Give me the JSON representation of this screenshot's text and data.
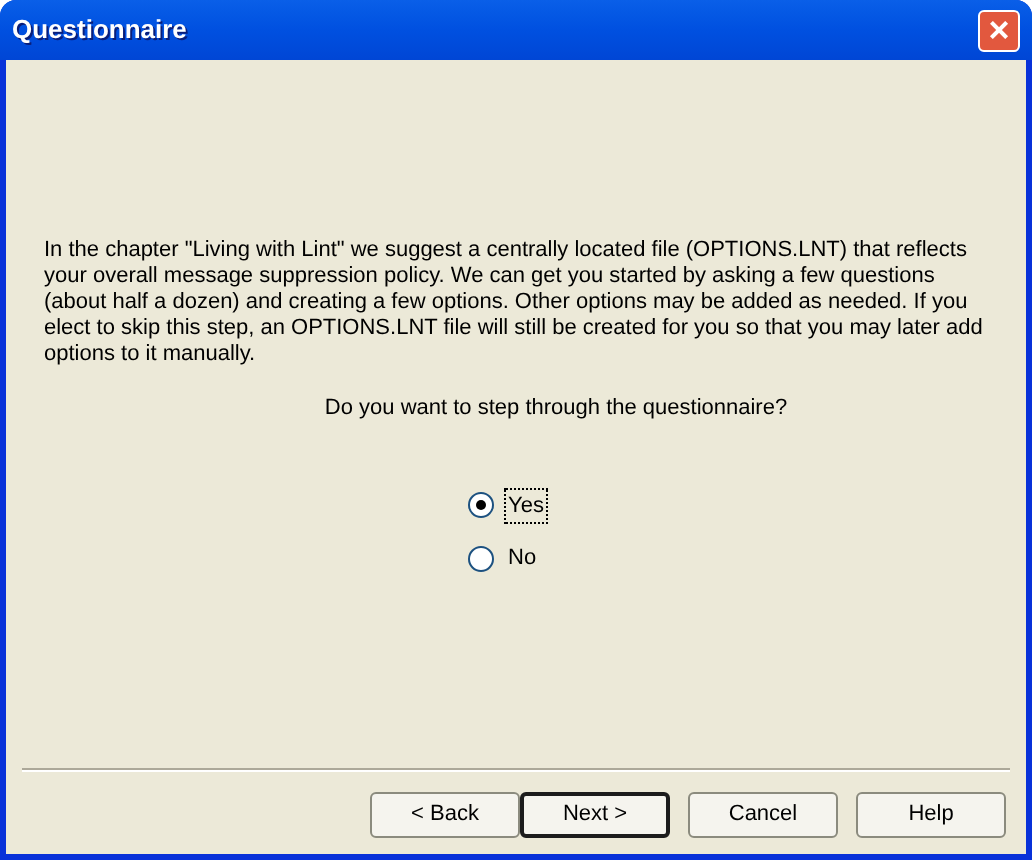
{
  "window": {
    "title": "Questionnaire",
    "close": "×"
  },
  "description": "In the chapter \"Living with Lint\" we suggest a centrally located file (OPTIONS.LNT) that reflects your overall message suppression policy.  We can get you started by asking a few questions (about half a dozen) and creating a few options.  Other options may be added as needed. If you elect to skip this step, an OPTIONS.LNT file will still be created for you so that you may later add options to it manually.",
  "question": "Do you want to step through the questionnaire?",
  "options": [
    {
      "label": "Yes",
      "selected": true,
      "focused": true
    },
    {
      "label": "No",
      "selected": false,
      "focused": false
    }
  ],
  "buttons": [
    {
      "label": "< Back",
      "default": false
    },
    {
      "label": "Next >",
      "default": true
    },
    {
      "label": "Cancel",
      "default": false
    },
    {
      "label": "Help",
      "default": false
    }
  ]
}
